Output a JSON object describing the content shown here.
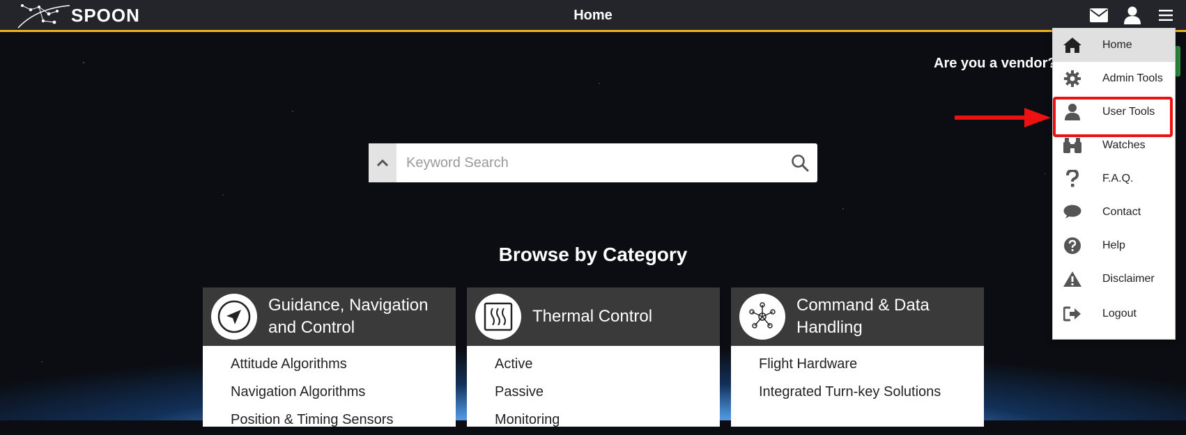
{
  "header": {
    "logo_text": "SPOON",
    "title": "Home",
    "icons": [
      "envelope-icon",
      "user-icon",
      "hamburger-menu-icon"
    ]
  },
  "vendor_prompt": "Are you a vendor?",
  "search": {
    "placeholder": "Keyword Search",
    "value": ""
  },
  "browse": {
    "title": "Browse by Category",
    "categories": [
      {
        "title": "Guidance, Navigation and Control",
        "icon": "navigation-arrow-icon",
        "items": [
          "Attitude Algorithms",
          "Navigation Algorithms",
          "Position & Timing Sensors"
        ]
      },
      {
        "title": "Thermal Control",
        "icon": "heat-waves-icon",
        "items": [
          "Active",
          "Passive",
          "Monitoring"
        ]
      },
      {
        "title": "Command & Data Handling",
        "icon": "network-nodes-icon",
        "items": [
          "Flight Hardware",
          "Integrated Turn-key Solutions"
        ]
      }
    ]
  },
  "menu": {
    "items": [
      {
        "label": "Home",
        "icon": "home-icon",
        "active": true
      },
      {
        "label": "Admin Tools",
        "icon": "gear-icon"
      },
      {
        "label": "User Tools",
        "icon": "user-icon",
        "highlighted": true
      },
      {
        "label": "Watches",
        "icon": "binoculars-icon"
      },
      {
        "label": "F.A.Q.",
        "icon": "question-mark-icon"
      },
      {
        "label": "Contact",
        "icon": "speech-bubble-icon"
      },
      {
        "label": "Help",
        "icon": "question-circle-icon"
      },
      {
        "label": "Disclaimer",
        "icon": "warning-triangle-icon"
      },
      {
        "label": "Logout",
        "icon": "sign-out-icon"
      }
    ]
  },
  "colors": {
    "header_bg": "#24252b",
    "header_accent": "#f2b41e",
    "highlight": "#ee1111",
    "card_header": "#3a3a3a"
  }
}
